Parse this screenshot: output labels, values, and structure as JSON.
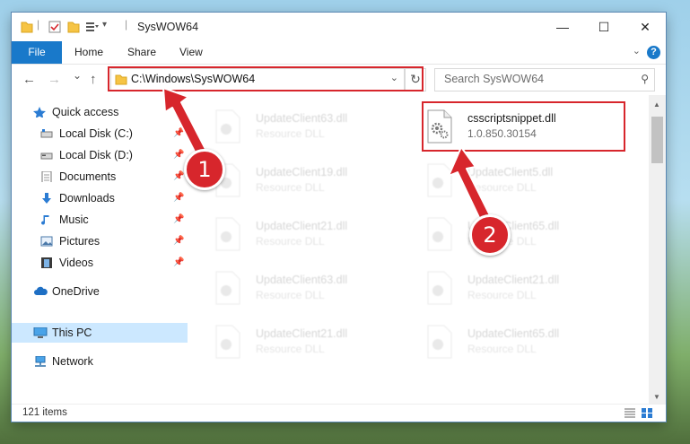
{
  "window": {
    "title": "SysWOW64",
    "controls": {
      "minimize": "—",
      "maximize": "☐",
      "close": "✕"
    }
  },
  "ribbon": {
    "file": "File",
    "tabs": [
      "Home",
      "Share",
      "View"
    ],
    "help": "?"
  },
  "nav": {
    "back": "←",
    "forward": "→",
    "recent": "⌄",
    "up": "↑",
    "address": "C:\\Windows\\SysWOW64",
    "refresh": "↻",
    "search_placeholder": "Search SysWOW64"
  },
  "sidebar": {
    "items": [
      {
        "label": "Quick access",
        "icon": "star-icon",
        "pinned": false
      },
      {
        "label": "Local Disk (C:)",
        "icon": "drive-icon",
        "pinned": true
      },
      {
        "label": "Local Disk (D:)",
        "icon": "drive-icon",
        "pinned": true
      },
      {
        "label": "Documents",
        "icon": "documents-icon",
        "pinned": true
      },
      {
        "label": "Downloads",
        "icon": "download-icon",
        "pinned": true
      },
      {
        "label": "Music",
        "icon": "music-icon",
        "pinned": true
      },
      {
        "label": "Pictures",
        "icon": "pictures-icon",
        "pinned": true
      },
      {
        "label": "Videos",
        "icon": "videos-icon",
        "pinned": true
      },
      {
        "label": "OneDrive",
        "icon": "cloud-icon",
        "pinned": false
      },
      {
        "label": "This PC",
        "icon": "computer-icon",
        "pinned": false
      },
      {
        "label": "Network",
        "icon": "network-icon",
        "pinned": false
      }
    ],
    "pin_glyph": "📌"
  },
  "files": [
    {
      "name": "UpdateClient63.dll",
      "type": "Resource DLL"
    },
    {
      "name": "csscriptsnippet.dll",
      "type": "1.0.850.30154"
    },
    {
      "name": "UpdateClient19.dll",
      "type": "Resource DLL"
    },
    {
      "name": "UpdateClient5.dll",
      "type": "Resource DLL"
    },
    {
      "name": "UpdateClient21.dll",
      "type": "Resource DLL"
    },
    {
      "name": "UpdateClient65.dll",
      "type": "Resource DLL"
    },
    {
      "name": "UpdateClient63.dll",
      "type": "Resource DLL"
    },
    {
      "name": "UpdateClient21.dll",
      "type": "Resource DLL"
    },
    {
      "name": "UpdateClient21.dll",
      "type": "Resource DLL"
    },
    {
      "name": "UpdateClient65.dll",
      "type": "Resource DLL"
    }
  ],
  "status": {
    "item_count": "121 items"
  },
  "annotations": {
    "step1": "1",
    "step2": "2"
  },
  "colors": {
    "accent": "#1979ca",
    "highlight": "#d7262c",
    "selected": "#cce8ff"
  }
}
